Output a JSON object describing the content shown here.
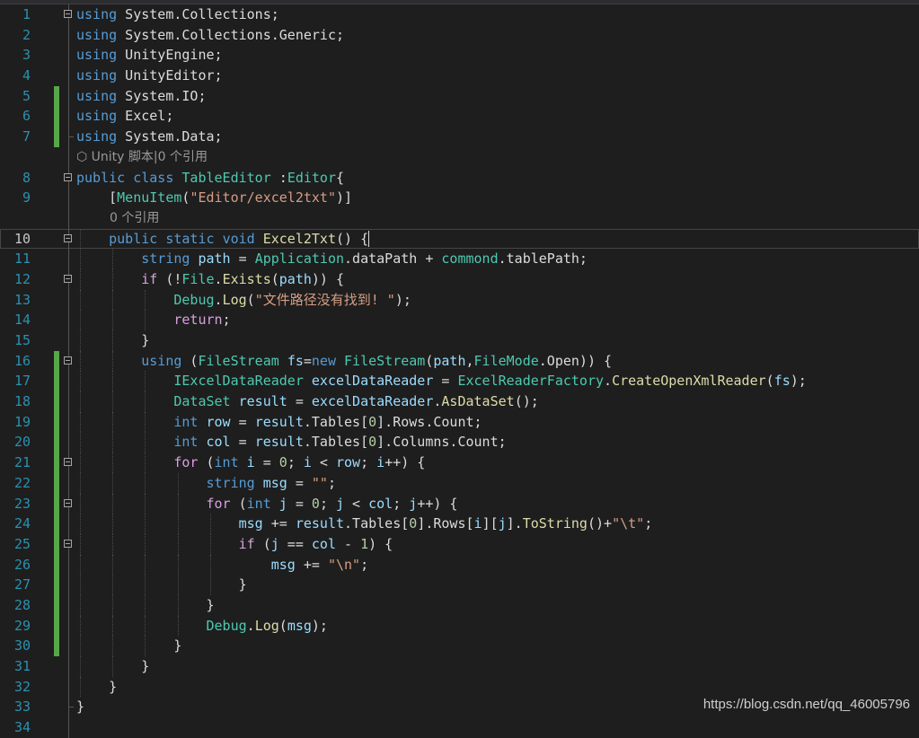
{
  "editor": {
    "lines": [
      {
        "n": "1",
        "fold": true,
        "chg": false,
        "html": "<span class=\"kw\">using</span> System.Collections;"
      },
      {
        "n": "2",
        "fold": false,
        "chg": false,
        "html": "<span class=\"kw\">using</span> System.Collections.Generic;"
      },
      {
        "n": "3",
        "fold": false,
        "chg": false,
        "html": "<span class=\"kw\">using</span> UnityEngine;"
      },
      {
        "n": "4",
        "fold": false,
        "chg": false,
        "html": "<span class=\"kw\">using</span> UnityEditor;"
      },
      {
        "n": "5",
        "fold": false,
        "chg": true,
        "html": "<span class=\"kw\">using</span> System.IO;"
      },
      {
        "n": "6",
        "fold": false,
        "chg": true,
        "html": "<span class=\"kw\">using</span> Excel;"
      },
      {
        "n": "7",
        "fold": false,
        "chg": true,
        "html": "<span class=\"kw\">using</span> System.Data;",
        "guideEnd": true
      },
      {
        "n": "",
        "lens": "⬡ Unity 脚本|0 个引用",
        "lensLeft": 85
      },
      {
        "n": "8",
        "fold": true,
        "chg": false,
        "html": "<span class=\"kw\">public</span> <span class=\"kw\">class</span> <span class=\"ty\">TableEditor</span> :<span class=\"ty\">Editor</span>{"
      },
      {
        "n": "9",
        "fold": false,
        "chg": false,
        "html": "    [<span class=\"ty\">MenuItem</span>(<span class=\"st\">\"Editor/excel2txt\"</span>)]"
      },
      {
        "n": "",
        "lens": "0 个引用",
        "lensLeft": 122
      },
      {
        "n": "10",
        "fold": true,
        "chg": false,
        "current": true,
        "html": "    <span class=\"kw\">public</span> <span class=\"kw\">static</span> <span class=\"kw\">void</span> <span class=\"mt\">Excel2Txt</span>() {<span class=\"cursor\"></span>"
      },
      {
        "n": "11",
        "fold": false,
        "chg": false,
        "html": "        <span class=\"kw\">string</span> <span class=\"vr\">path</span> = <span class=\"ty\">Application</span>.dataPath + <span class=\"ty\">commond</span>.tablePath;"
      },
      {
        "n": "12",
        "fold": true,
        "chg": false,
        "html": "        <span class=\"ctl\">if</span> (!<span class=\"ty\">File</span>.<span class=\"mt\">Exists</span>(<span class=\"vr\">path</span>)) {"
      },
      {
        "n": "13",
        "fold": false,
        "chg": false,
        "html": "            <span class=\"ty\">Debug</span>.<span class=\"mt\">Log</span>(<span class=\"st\">\"文件路径没有找到! \"</span>);"
      },
      {
        "n": "14",
        "fold": false,
        "chg": false,
        "html": "            <span class=\"ctl\">return</span>;"
      },
      {
        "n": "15",
        "fold": false,
        "chg": false,
        "html": "        }"
      },
      {
        "n": "16",
        "fold": true,
        "chg": true,
        "html": "        <span class=\"kw\">using</span> (<span class=\"ty\">FileStream</span> <span class=\"vr\">fs</span>=<span class=\"kw\">new</span> <span class=\"ty\">FileStream</span>(<span class=\"vr\">path</span>,<span class=\"ty\">FileMode</span>.Open)) {"
      },
      {
        "n": "17",
        "fold": false,
        "chg": true,
        "html": "            <span class=\"ty\">IExcelDataReader</span> <span class=\"vr\">excelDataReader</span> = <span class=\"ty\">ExcelReaderFactory</span>.<span class=\"mt\">CreateOpenXmlReader</span>(<span class=\"vr\">fs</span>);"
      },
      {
        "n": "18",
        "fold": false,
        "chg": true,
        "html": "            <span class=\"ty\">DataSet</span> <span class=\"vr\">result</span> = <span class=\"vr\">excelDataReader</span>.<span class=\"mt\">AsDataSet</span>();"
      },
      {
        "n": "19",
        "fold": false,
        "chg": true,
        "html": "            <span class=\"kw\">int</span> <span class=\"vr\">row</span> = <span class=\"vr\">result</span>.Tables[<span class=\"nm\">0</span>].Rows.Count;"
      },
      {
        "n": "20",
        "fold": false,
        "chg": true,
        "html": "            <span class=\"kw\">int</span> <span class=\"vr\">col</span> = <span class=\"vr\">result</span>.Tables[<span class=\"nm\">0</span>].Columns.Count;"
      },
      {
        "n": "21",
        "fold": true,
        "chg": true,
        "html": "            <span class=\"ctl\">for</span> (<span class=\"kw\">int</span> <span class=\"vr\">i</span> = <span class=\"nm\">0</span>; <span class=\"vr\">i</span> &lt; <span class=\"vr\">row</span>; <span class=\"vr\">i</span>++) {"
      },
      {
        "n": "22",
        "fold": false,
        "chg": true,
        "html": "                <span class=\"kw\">string</span> <span class=\"vr\">msg</span> = <span class=\"st\">\"\"</span>;"
      },
      {
        "n": "23",
        "fold": true,
        "chg": true,
        "html": "                <span class=\"ctl\">for</span> (<span class=\"kw\">int</span> <span class=\"vr\">j</span> = <span class=\"nm\">0</span>; <span class=\"vr\">j</span> &lt; <span class=\"vr\">col</span>; <span class=\"vr\">j</span>++) {"
      },
      {
        "n": "24",
        "fold": false,
        "chg": true,
        "html": "                    <span class=\"vr\">msg</span> += <span class=\"vr\">result</span>.Tables[<span class=\"nm\">0</span>].Rows[<span class=\"vr\">i</span>][<span class=\"vr\">j</span>].<span class=\"mt\">ToString</span>()+<span class=\"st\">\"\\t\"</span>;"
      },
      {
        "n": "25",
        "fold": true,
        "chg": true,
        "html": "                    <span class=\"ctl\">if</span> (<span class=\"vr\">j</span> == <span class=\"vr\">col</span> - <span class=\"nm\">1</span>) {"
      },
      {
        "n": "26",
        "fold": false,
        "chg": true,
        "html": "                        <span class=\"vr\">msg</span> += <span class=\"st\">\"\\n\"</span>;"
      },
      {
        "n": "27",
        "fold": false,
        "chg": true,
        "html": "                    }"
      },
      {
        "n": "28",
        "fold": false,
        "chg": true,
        "html": "                }"
      },
      {
        "n": "29",
        "fold": false,
        "chg": true,
        "html": "                <span class=\"ty\">Debug</span>.<span class=\"mt\">Log</span>(<span class=\"vr\">msg</span>);"
      },
      {
        "n": "30",
        "fold": false,
        "chg": true,
        "html": "            }"
      },
      {
        "n": "31",
        "fold": false,
        "chg": false,
        "html": "        }"
      },
      {
        "n": "32",
        "fold": false,
        "chg": false,
        "html": "    }"
      },
      {
        "n": "33",
        "fold": false,
        "chg": false,
        "html": "}",
        "guideEnd": true
      },
      {
        "n": "34",
        "fold": false,
        "chg": false,
        "html": ""
      }
    ]
  },
  "watermark": "https://blog.csdn.net/qq_46005796"
}
